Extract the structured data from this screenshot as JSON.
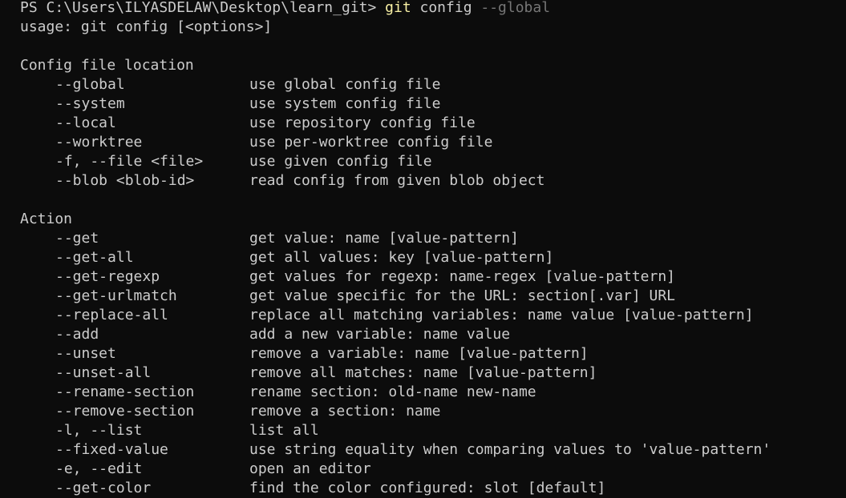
{
  "prompt": {
    "path": "PS C:\\Users\\ILYASDELAW\\Desktop\\learn_git> ",
    "command": "git",
    "args": " config",
    "flag": " --global"
  },
  "usage": "usage: git config [<options>]",
  "sections": [
    {
      "title": "Config file location",
      "options": [
        {
          "flag": "--global",
          "desc": "use global config file"
        },
        {
          "flag": "--system",
          "desc": "use system config file"
        },
        {
          "flag": "--local",
          "desc": "use repository config file"
        },
        {
          "flag": "--worktree",
          "desc": "use per-worktree config file"
        },
        {
          "flag": "-f, --file <file>",
          "desc": "use given config file"
        },
        {
          "flag": "--blob <blob-id>",
          "desc": "read config from given blob object"
        }
      ]
    },
    {
      "title": "Action",
      "options": [
        {
          "flag": "--get",
          "desc": "get value: name [value-pattern]"
        },
        {
          "flag": "--get-all",
          "desc": "get all values: key [value-pattern]"
        },
        {
          "flag": "--get-regexp",
          "desc": "get values for regexp: name-regex [value-pattern]"
        },
        {
          "flag": "--get-urlmatch",
          "desc": "get value specific for the URL: section[.var] URL"
        },
        {
          "flag": "--replace-all",
          "desc": "replace all matching variables: name value [value-pattern]"
        },
        {
          "flag": "--add",
          "desc": "add a new variable: name value"
        },
        {
          "flag": "--unset",
          "desc": "remove a variable: name [value-pattern]"
        },
        {
          "flag": "--unset-all",
          "desc": "remove all matches: name [value-pattern]"
        },
        {
          "flag": "--rename-section",
          "desc": "rename section: old-name new-name"
        },
        {
          "flag": "--remove-section",
          "desc": "remove a section: name"
        },
        {
          "flag": "-l, --list",
          "desc": "list all"
        },
        {
          "flag": "--fixed-value",
          "desc": "use string equality when comparing values to 'value-pattern'"
        },
        {
          "flag": "-e, --edit",
          "desc": "open an editor"
        },
        {
          "flag": "--get-color",
          "desc": "find the color configured: slot [default]"
        }
      ]
    }
  ],
  "colors": {
    "background": "#0c0c0c",
    "text": "#cccccc",
    "command": "#f9f1a5",
    "argument": "#767676"
  }
}
